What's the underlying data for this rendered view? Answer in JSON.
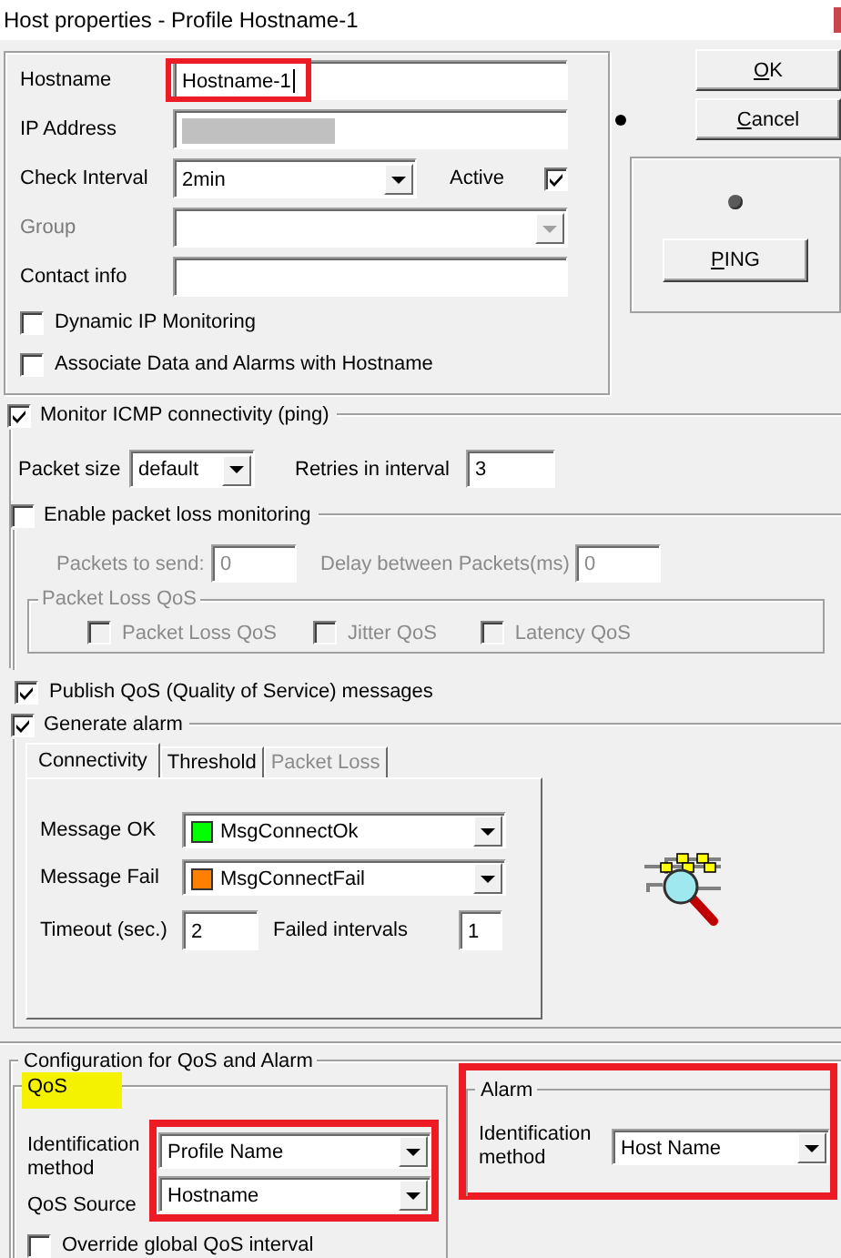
{
  "window": {
    "title": "Host properties - Profile Hostname-1"
  },
  "host_fields": [
    {
      "kind": "text",
      "label": "Hostname",
      "value": "Hostname-1",
      "highlighted": true
    },
    {
      "kind": "redacted",
      "label": "IP Address"
    },
    {
      "kind": "dropdown",
      "label": "Check Interval",
      "value": "2min",
      "disabled": false
    },
    {
      "kind": "dropdown",
      "label": "Group",
      "disabled": true
    },
    {
      "kind": "text",
      "label": "Contact info",
      "highlighted": false
    }
  ],
  "active": {
    "label": "Active",
    "checked": true
  },
  "host_options": [
    {
      "label": "Dynamic IP Monitoring",
      "checked": false
    },
    {
      "label": "Associate Data and Alarms with Hostname",
      "checked": false
    }
  ],
  "buttons": [
    {
      "label": "OK"
    },
    {
      "label": "Cancel"
    }
  ],
  "ping": {
    "button": "PING"
  },
  "icmp": {
    "label": "Monitor ICMP connectivity (ping)",
    "checked": true,
    "packet_size_label": "Packet size",
    "packet_size": "default",
    "retries_label": "Retries in interval",
    "retries": "3",
    "packet_loss": {
      "label": "Enable packet loss monitoring",
      "checked": false,
      "packets_label": "Packets to send:",
      "packets": "0",
      "delay_label": "Delay between Packets(ms)",
      "delay": "0",
      "qos_group": "Packet Loss QoS",
      "qos_options": [
        {
          "label": "Packet Loss QoS",
          "checked": false
        },
        {
          "label": "Jitter QoS",
          "checked": false
        },
        {
          "label": "Latency QoS",
          "checked": false
        }
      ]
    }
  },
  "publish_qos": {
    "label": "Publish QoS (Quality of Service) messages",
    "checked": true
  },
  "alarm": {
    "label": "Generate alarm",
    "checked": true,
    "tabs": [
      {
        "label": "Connectivity",
        "selected": true,
        "disabled": false
      },
      {
        "label": "Threshold",
        "selected": false,
        "disabled": false
      },
      {
        "label": "Packet Loss",
        "selected": false,
        "disabled": true
      }
    ],
    "messages": [
      {
        "label": "Message OK",
        "value": "MsgConnectOk",
        "color": "#00ff00"
      },
      {
        "label": "Message Fail",
        "value": "MsgConnectFail",
        "color": "#ff7f00"
      }
    ],
    "timeout_label": "Timeout (sec.)",
    "timeout": "2",
    "failed_label": "Failed intervals",
    "failed": "1"
  },
  "config": {
    "title": "Configuration for QoS and Alarm",
    "qos": {
      "title": "QoS",
      "title_marked": true,
      "fields_highlighted": true,
      "fields": [
        {
          "label": "Identification method",
          "value": "Profile Name"
        },
        {
          "label": "QoS Source",
          "value": "Hostname"
        }
      ],
      "override": {
        "label": "Override global QoS interval",
        "checked": false
      }
    },
    "alarm": {
      "title": "Alarm",
      "highlighted": true,
      "fields": [
        {
          "label": "Identification method",
          "value": "Host Name"
        }
      ]
    }
  }
}
